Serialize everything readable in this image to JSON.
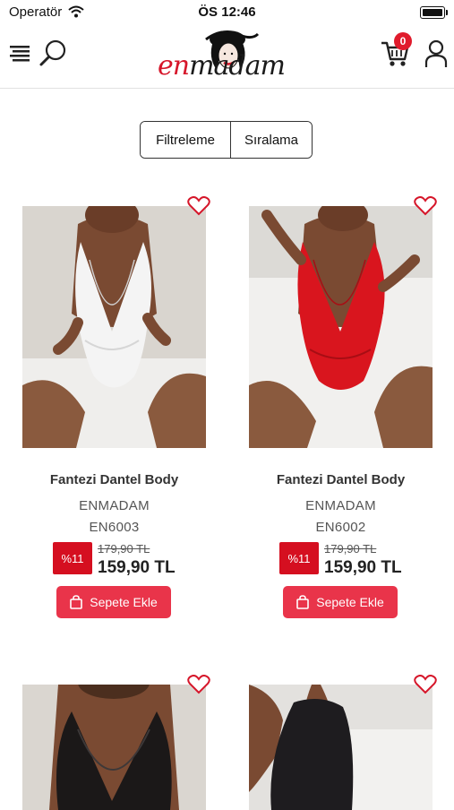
{
  "status_bar": {
    "carrier": "Operatör",
    "time": "ÖS 12:46"
  },
  "header": {
    "logo_text_en": "en",
    "logo_text_rest": "madam",
    "cart_count": "0",
    "icons": [
      "menu-icon",
      "search-icon",
      "cart-icon",
      "user-icon"
    ]
  },
  "filter_bar": {
    "filter_label": "Filtreleme",
    "sort_label": "Sıralama"
  },
  "products": [
    {
      "name": "Fantezi Dantel Body",
      "brand": "ENMADAM",
      "code": "EN6003",
      "discount": "%11",
      "old_price": "179,90 TL",
      "price": "159,90 TL",
      "button_label": "Sepete Ekle",
      "image_color": "white lace"
    },
    {
      "name": "Fantezi Dantel Body",
      "brand": "ENMADAM",
      "code": "EN6002",
      "discount": "%11",
      "old_price": "179,90 TL",
      "price": "159,90 TL",
      "button_label": "Sepete Ekle",
      "image_color": "red lace"
    },
    {
      "image_color": "black lace"
    },
    {
      "image_color": "black halter"
    }
  ],
  "colors": {
    "accent": "#e9344a",
    "badge_red": "#d50f20",
    "cart_badge": "#e01b2c",
    "heart_outline": "#d6162a"
  }
}
